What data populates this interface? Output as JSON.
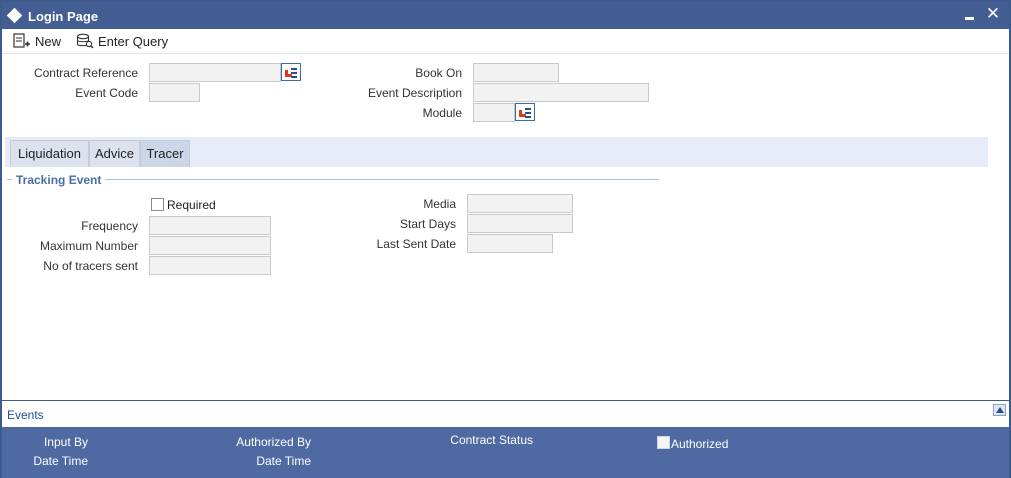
{
  "window": {
    "title": "Login Page",
    "minimize_icon": "minimize-icon",
    "close_icon": "close-icon"
  },
  "toolbar": {
    "new_label": "New",
    "enter_query_label": "Enter Query"
  },
  "header": {
    "contract_reference_label": "Contract Reference",
    "contract_reference_value": "",
    "event_code_label": "Event Code",
    "event_code_value": "",
    "book_on_label": "Book On",
    "book_on_value": "",
    "event_description_label": "Event Description",
    "event_description_value": "",
    "module_label": "Module",
    "module_value": ""
  },
  "tabs": [
    {
      "label": "Liquidation"
    },
    {
      "label": "Advice"
    },
    {
      "label": "Tracer"
    }
  ],
  "tracking": {
    "section_title": "Tracking Event",
    "required_label": "Required",
    "required_checked": false,
    "frequency_label": "Frequency",
    "frequency_value": "",
    "maximum_number_label": "Maximum Number",
    "maximum_number_value": "",
    "tracers_sent_label": "No of tracers sent",
    "tracers_sent_value": "",
    "media_label": "Media",
    "media_value": "",
    "start_days_label": "Start Days",
    "start_days_value": "",
    "last_sent_date_label": "Last Sent Date",
    "last_sent_date_value": ""
  },
  "events": {
    "label": "Events"
  },
  "footer": {
    "input_by_label": "Input By",
    "date_time_label_1": "Date Time",
    "authorized_by_label": "Authorized By",
    "date_time_label_2": "Date Time",
    "contract_status_label": "Contract Status",
    "authorized_label": "Authorized",
    "authorized_checked": false
  },
  "colors": {
    "titlebar": "#445d93",
    "footer": "#4f6aa3",
    "section_title": "#4b6ea6",
    "tab_strip": "#e6ecf7"
  }
}
